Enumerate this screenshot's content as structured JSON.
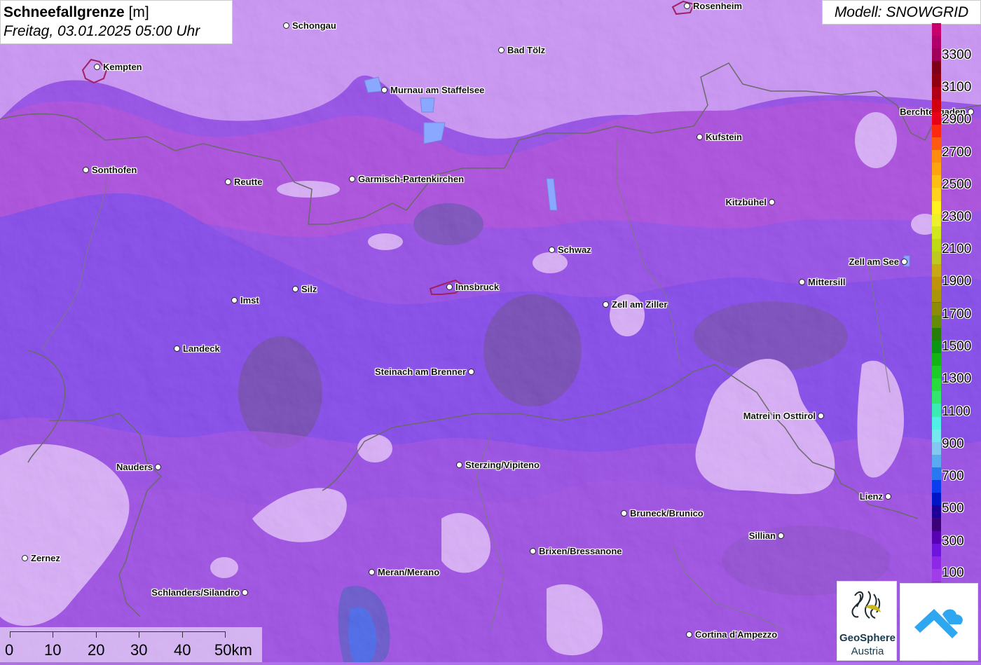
{
  "title": {
    "main": "Schneefallgrenze",
    "unit": "[m]",
    "datetime": "Freitag, 03.01.2025 05:00 Uhr"
  },
  "model": "Modell: SNOWGRID",
  "cities": [
    {
      "name": "Rosenheim",
      "side": "right"
    },
    {
      "name": "Schongau",
      "side": "right"
    },
    {
      "name": "Bad Tölz",
      "side": "right"
    },
    {
      "name": "Kempten",
      "side": "right"
    },
    {
      "name": "Murnau am Staffelsee",
      "side": "right"
    },
    {
      "name": "Berchtesgaden",
      "side": "left"
    },
    {
      "name": "Kufstein",
      "side": "right"
    },
    {
      "name": "Sonthofen",
      "side": "right"
    },
    {
      "name": "Reutte",
      "side": "right"
    },
    {
      "name": "Garmisch-Partenkirchen",
      "side": "right"
    },
    {
      "name": "Kitzbühel",
      "side": "left"
    },
    {
      "name": "Schwaz",
      "side": "right"
    },
    {
      "name": "Zell am See",
      "side": "left"
    },
    {
      "name": "Mittersill",
      "side": "right"
    },
    {
      "name": "Innsbruck",
      "side": "right"
    },
    {
      "name": "Silz",
      "side": "right"
    },
    {
      "name": "Imst",
      "side": "right"
    },
    {
      "name": "Zell am Ziller",
      "side": "right"
    },
    {
      "name": "Landeck",
      "side": "right"
    },
    {
      "name": "Steinach am Brenner",
      "side": "left"
    },
    {
      "name": "Matrei in Osttirol",
      "side": "left"
    },
    {
      "name": "Nauders",
      "side": "left"
    },
    {
      "name": "Sterzing/Vipiteno",
      "side": "right"
    },
    {
      "name": "Lienz",
      "side": "left"
    },
    {
      "name": "Bruneck/Brunico",
      "side": "right"
    },
    {
      "name": "Sillian",
      "side": "left"
    },
    {
      "name": "Zernez",
      "side": "right"
    },
    {
      "name": "Brixen/Bressanone",
      "side": "right"
    },
    {
      "name": "Meran/Merano",
      "side": "right"
    },
    {
      "name": "Schlanders/Silandro",
      "side": "left"
    },
    {
      "name": "Cortina d'Ampezzo",
      "side": "right"
    }
  ],
  "legend": {
    "labels": [
      "3300",
      "3100",
      "2900",
      "2700",
      "2500",
      "2300",
      "2100",
      "1900",
      "1700",
      "1500",
      "1300",
      "1100",
      "900",
      "700",
      "500",
      "300",
      "100"
    ],
    "colors": [
      "#c8006e",
      "#b0006a",
      "#a0005a",
      "#800018",
      "#900010",
      "#b00018",
      "#d00010",
      "#e80018",
      "#ff2810",
      "#ff5a10",
      "#ff8c10",
      "#ffa410",
      "#ffbe14",
      "#ffd21e",
      "#fff21e",
      "#eef02a",
      "#d2e61e",
      "#beda14",
      "#bec81e",
      "#c8a814",
      "#c0940a",
      "#aa960a",
      "#8c8c08",
      "#648c08",
      "#287c08",
      "#0a9614",
      "#14b414",
      "#1ecc28",
      "#28dc3c",
      "#32e66e",
      "#3ceab4",
      "#50f0e6",
      "#78e6f0",
      "#82c8f0",
      "#5aaaf0",
      "#2878f0",
      "#0a3cf0",
      "#0014c8",
      "#1e0096",
      "#3c0078",
      "#5a00b4",
      "#6e14dc",
      "#8c28e6",
      "#a03cea"
    ]
  },
  "scale": {
    "labels": [
      "0",
      "10",
      "20",
      "30",
      "40",
      "50km"
    ]
  },
  "logo": {
    "line1": "GeoSphere",
    "line2": "Austria"
  }
}
